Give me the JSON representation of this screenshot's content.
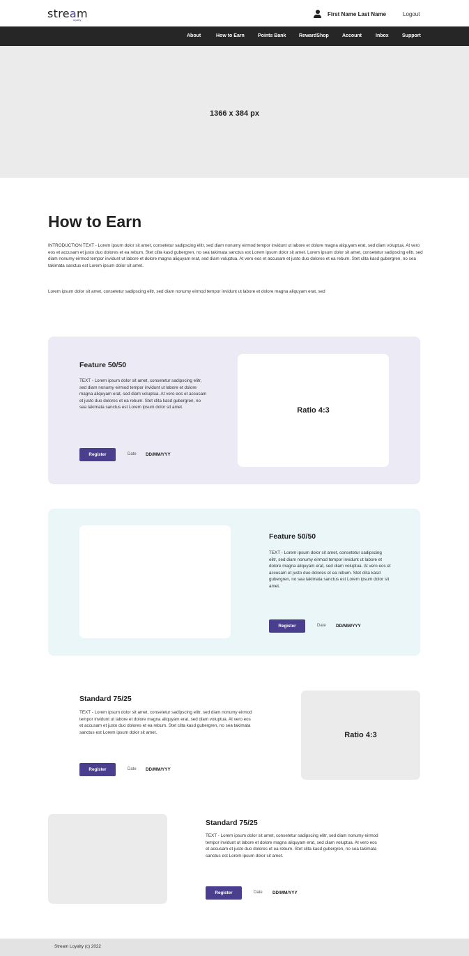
{
  "header": {
    "logo_text_a": "stre",
    "logo_text_o": "a",
    "logo_text_b": "m",
    "logo_sub": "loyalty",
    "user_name": "First Name Last Name",
    "logout_label": "Logout"
  },
  "nav": {
    "items": [
      "About",
      "How to Earn",
      "Points Bank",
      "RewardShop",
      "Account",
      "Inbox",
      "Support"
    ]
  },
  "hero": {
    "label": "1366 x 384 px"
  },
  "main": {
    "title": "How to Earn",
    "intro": "INTRODUCTION TEXT - Lorem ipsum dolor sit amet, consetetur sadipscing elitr, sed diam nonumy eirmod tempor invidunt ut labore et dolore magna aliquyam erat, sed diam voluptua. At vero eos et accusam et justo duo dolores et ea rebum. Stet clita kasd gubergren, no sea takimata sanctus est Lorem ipsum dolor sit amet. Lorem ipsum dolor sit amet, consetetur sadipscing elitr, sed diam nonumy eirmod tempor invidunt ut labore et dolore magna aliquyam erat, sed diam voluptua. At vero eos et accusam et justo duo dolores et ea rebum. Stet clita kasd gubergren, no sea takimata sanctus est Lorem ipsum dolor sit amet.",
    "intro2": "Lorem ipsum dolor sit amet, consetetur sadipscing elitr, sed diam nonumy eirmod tempor invidunt ut labore et dolore magna aliquyam erat, sed"
  },
  "cards": [
    {
      "title": "Feature 50/50",
      "text": "TEXT - Lorem ipsum dolor sit amet, consetetur sadipscing elitr, sed diam nonumy eirmod tempor invidunt ut labore et dolore magna aliquyam erat, sed diam voluptua. At vero eos et accusam et justo duo dolores et ea rebum. Stet clita kasd gubergren, no sea takimata sanctus est Lorem ipsum dolor sit amet.",
      "button": "Register",
      "date_label": "Date",
      "date_value": "DD/MM/YYY",
      "image_label": "Ratio 4:3"
    },
    {
      "title": "Feature 50/50",
      "text": "TEXT - Lorem ipsum dolor sit amet, consetetur sadipscing elitr, sed diam nonumy eirmod tempor invidunt ut labore et dolore magna aliquyam erat, sed diam voluptua. At vero eos et accusam et justo duo dolores et ea rebum. Stet clita kasd gubergren, no sea takimata sanctus est Lorem ipsum dolor sit amet.",
      "button": "Register",
      "date_label": "Date",
      "date_value": "DD/MM/YYY"
    },
    {
      "title": "Standard 75/25",
      "text": "TEXT - Lorem ipsum dolor sit amet, consetetur sadipscing elitr, sed diam nonumy eirmod tempor invidunt ut labore et dolore magna aliquyam erat, sed diam voluptua. At vero eos et accusam et justo duo dolores et ea rebum. Stet clita kasd gubergren, no sea takimata sanctus est Lorem ipsum dolor sit amet.",
      "button": "Register",
      "date_label": "Date",
      "date_value": "DD/MM/YYY",
      "image_label": "Ratio 4:3"
    },
    {
      "title": "Standard 75/25",
      "text": "TEXT - Lorem ipsum dolor sit amet, consetetur sadipscing elitr, sed diam nonumy eirmod tempor invidunt ut labore et dolore magna aliquyam erat, sed diam voluptua. At vero eos et accusam et justo duo dolores et ea rebum. Stet clita kasd gubergren, no sea takimata sanctus est Lorem ipsum dolor sit amet.",
      "button": "Register",
      "date_label": "Date",
      "date_value": "DD/MM/YYY"
    }
  ],
  "footer": {
    "text": "Stream Loyalty (c) 2022"
  },
  "colors": {
    "accent": "#4a3f8f",
    "nav_bg": "#262626",
    "card1_bg": "#ecebf5",
    "card2_bg": "#ebf6f9",
    "placeholder_bg": "#ebebeb"
  },
  "icons": {
    "user": "user-icon"
  }
}
